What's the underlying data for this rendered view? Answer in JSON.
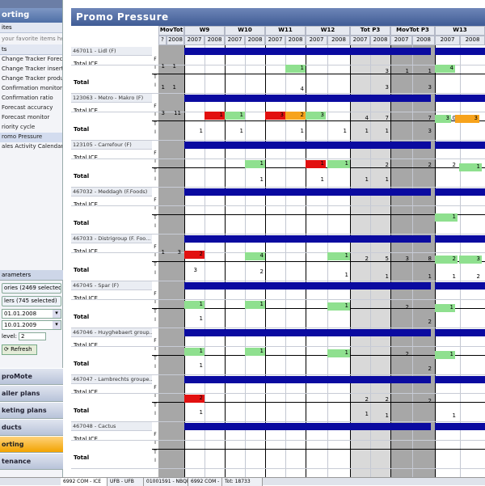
{
  "sidebar": {
    "title": "orting",
    "favorites_header": "ites",
    "favorites_hint": "your favorite items here.",
    "reports_header": "ts",
    "items": [
      {
        "label": "Change Tracker Forecasts"
      },
      {
        "label": "Change Tracker insertion pro"
      },
      {
        "label": "Change Tracker products"
      },
      {
        "label": "Confirmation monitor"
      },
      {
        "label": "Confirmation ratio"
      },
      {
        "label": "Forecast accuracy"
      },
      {
        "label": "Forecast monitor"
      },
      {
        "label": "riority cycle"
      },
      {
        "label": "romo Pressure"
      },
      {
        "label": "ales Activity Calendar"
      }
    ],
    "params_header": "arameters",
    "categories_btn": "ories (2469 selected)",
    "retailers_btn": "lers (745 selected)",
    "date_from": "01.01.2008",
    "date_to": "10.01.2009",
    "level_label": "level:",
    "level_value": "2",
    "refresh_label": "Refresh",
    "modules": [
      "proMote",
      "ailer plans",
      "keting plans",
      "ducts",
      "orting",
      "tenance"
    ]
  },
  "main": {
    "title": "Promo Pressure",
    "col_groups": [
      "MovTot",
      "W9",
      "W10",
      "W11",
      "W12",
      "Tot P3",
      "MovTot P3",
      "W13"
    ],
    "years": [
      "?",
      "2008",
      "2007",
      "2008",
      "2007",
      "2008",
      "2007",
      "2008",
      "2007",
      "2008",
      "2007",
      "2008",
      "2007",
      "2008",
      "2007",
      "2008"
    ]
  },
  "groups": [
    {
      "head": "467011 - Lidl (F)",
      "label_ice": "Total ICE",
      "label_total": "Total"
    },
    {
      "head": "123063 - Metro - Makro (F)",
      "label_ice": "Total ICE",
      "label_total": "Total",
      "vals": {
        "a": "1",
        "b": "1",
        "c": "1",
        "d": "3",
        "e": "1",
        "f": "1",
        "g": "4",
        "h": "4",
        "i": "3",
        "j": "3",
        "k": "1",
        "l": "1"
      }
    },
    {
      "head": "123105 - Carrefour (F)",
      "label_ice": "Total ICE",
      "label_total": "Total",
      "vals": {
        "a": "3",
        "b": "11",
        "c": "1",
        "d": "1",
        "e": "3",
        "f": "2",
        "g": "3",
        "h": "4",
        "i": "7",
        "j": "7",
        "k": "10",
        "l": "3",
        "m": "3",
        "n": "1",
        "o": "1",
        "p": "1",
        "q": "1",
        "r": "1",
        "s": "1",
        "t": "3"
      }
    },
    {
      "head": "467032 - Meddagh (F.Foods)",
      "label_ice": "Total ICE",
      "label_total": "Total",
      "vals": {
        "a": "1",
        "b": "1",
        "c": "1",
        "d": "2",
        "e": "2",
        "f": "2",
        "g": "1",
        "h": "1",
        "i": "1",
        "j": "1",
        "k": "1"
      }
    },
    {
      "head": "467033 - Distrigroup (F. Foo...",
      "label_ice": "Total ICE",
      "label_total": "Total",
      "vals": {
        "a": "1"
      }
    },
    {
      "head": "467045 - Spar (F)",
      "label_ice": "Total ICE",
      "label_total": "Total",
      "vals": {
        "a": "1",
        "b": "3",
        "c": "2",
        "d": "4",
        "e": "1",
        "f": "2",
        "g": "5",
        "h": "3",
        "i": "8",
        "j": "2",
        "k": "3",
        "l": "3",
        "m": "2",
        "n": "1",
        "o": "1",
        "p": "1",
        "q": "1",
        "r": "2"
      }
    },
    {
      "head": "467046 - Huyghebaert group...",
      "label_ice": "Total ICE",
      "label_total": "Total",
      "vals": {
        "a": "1",
        "b": "1",
        "c": "1",
        "d": "1",
        "e": "2",
        "f": "1",
        "g": "2"
      }
    },
    {
      "head": "467047 - Lambrechts groupe...",
      "label_ice": "Total ICE",
      "label_total": "Total",
      "vals": {
        "a": "1",
        "b": "1",
        "c": "1",
        "d": "1",
        "e": "2",
        "f": "1",
        "g": "2"
      }
    },
    {
      "head": "467048 - Cactus",
      "label_ice": "Total ICE",
      "label_total": "Total",
      "vals": {
        "a": "2",
        "b": "2",
        "c": "2",
        "d": "2",
        "e": "1",
        "f": "1",
        "g": "1",
        "h": "1"
      }
    }
  ],
  "row_codes": [
    "F",
    "I",
    "T",
    "I"
  ],
  "tabs": [
    "6992 COM - ICE",
    "UFB - UFB",
    "01001591 - NBQF",
    "6992 COM -",
    "Tot: 18733"
  ]
}
